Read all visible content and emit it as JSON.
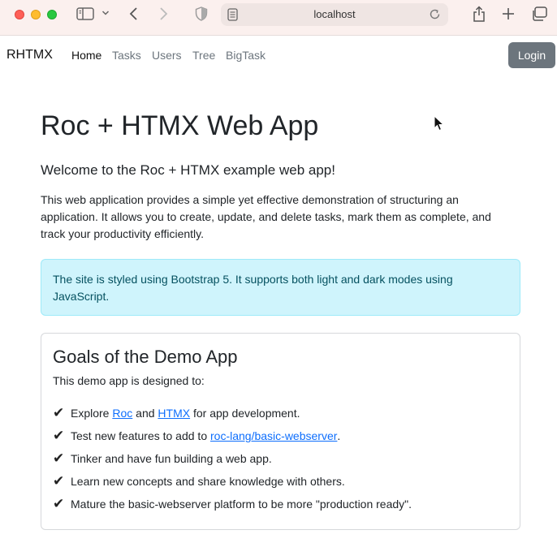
{
  "browser": {
    "url": "localhost"
  },
  "navbar": {
    "brand": "RHTMX",
    "links": [
      "Home",
      "Tasks",
      "Users",
      "Tree",
      "BigTask"
    ],
    "login_label": "Login"
  },
  "main": {
    "title": "Roc + HTMX Web App",
    "lead": "Welcome to the Roc + HTMX example web app!",
    "description": "This web application provides a simple yet effective demonstration of structuring an application. It allows you to create, update, and delete tasks, mark them as complete, and track your productivity efficiently.",
    "alert": "The site is styled using Bootstrap 5. It supports both light and dark modes using JavaScript."
  },
  "card": {
    "title": "Goals of the Demo App",
    "intro": "This demo app is designed to:",
    "goal1": {
      "pre": "Explore ",
      "link1": "Roc",
      "mid": " and ",
      "link2": "HTMX",
      "post": " for app development."
    },
    "goal2": {
      "pre": "Test new features to add to ",
      "link": "roc-lang/basic-webserver",
      "post": "."
    },
    "goal3": "Tinker and have fun building a web app.",
    "goal4": "Learn new concepts and share knowledge with others.",
    "goal5": "Mature the basic-webserver platform to be more \"production ready\".",
    "check": "✔"
  },
  "colors": {
    "alert_bg": "#cff4fc",
    "alert_text": "#055160",
    "link": "#0d6efd",
    "login_bg": "#6c757d"
  }
}
